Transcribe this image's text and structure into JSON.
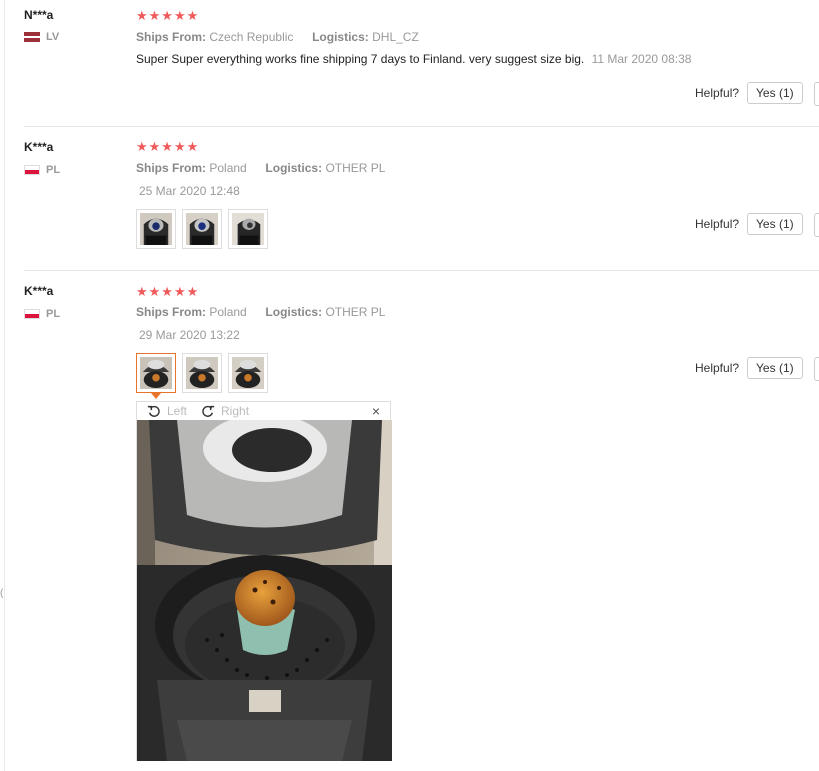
{
  "reviews": [
    {
      "user": "N***a",
      "country": "LV",
      "stars": "★★★★★",
      "ships_from_label": "Ships From:",
      "ships_from": "Czech Republic",
      "logistics_label": "Logistics:",
      "logistics": "DHL_CZ",
      "text": "Super Super everything works fine shipping 7 days to Finland. very suggest size big.",
      "date": "11 Mar 2020 08:38",
      "helpful_label": "Helpful?",
      "yes_label": "Yes (1)"
    },
    {
      "user": "K***a",
      "country": "PL",
      "stars": "★★★★★",
      "ships_from_label": "Ships From:",
      "ships_from": "Poland",
      "logistics_label": "Logistics:",
      "logistics": "OTHER PL",
      "date": "25 Mar 2020 12:48",
      "helpful_label": "Helpful?",
      "yes_label": "Yes (1)"
    },
    {
      "user": "K***a",
      "country": "PL",
      "stars": "★★★★★",
      "ships_from_label": "Ships From:",
      "ships_from": "Poland",
      "logistics_label": "Logistics:",
      "logistics": "OTHER PL",
      "date": "29 Mar 2020 13:22",
      "helpful_label": "Helpful?",
      "yes_label": "Yes (1)"
    }
  ],
  "viewer": {
    "rotate_left_label": "Left",
    "rotate_right_label": "Right",
    "close_glyph": "×"
  },
  "colors": {
    "star": "#f05a5a",
    "active_thumb": "#e8742c",
    "muted_text": "#999999"
  }
}
